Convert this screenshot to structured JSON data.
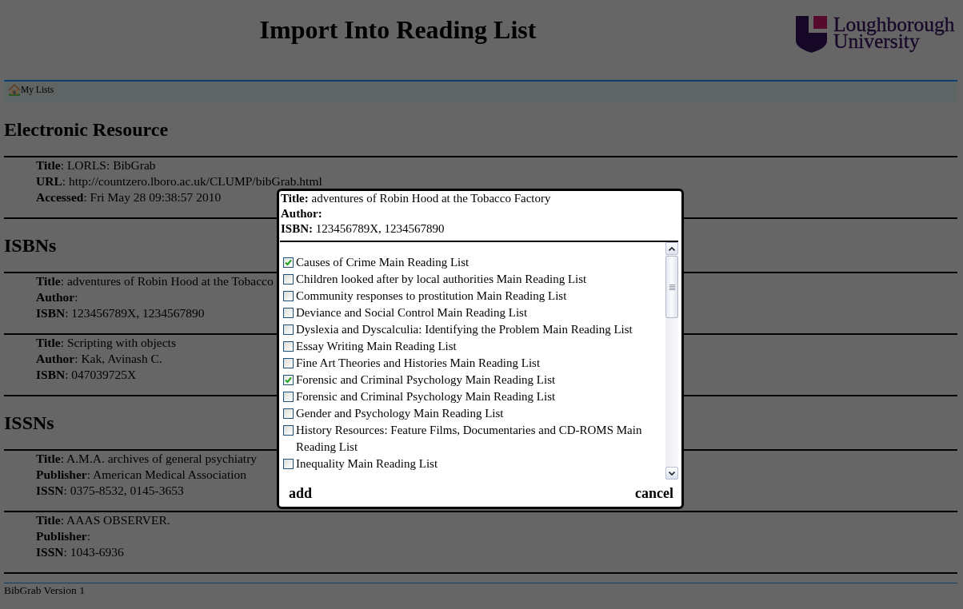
{
  "header": {
    "title": "Import Into Reading List",
    "logo_text": [
      "Loughborough",
      "University"
    ]
  },
  "nav": {
    "link": "My Lists"
  },
  "sections": [
    {
      "heading": "Electronic Resource",
      "records": [
        {
          "fields": [
            "**Title**: LORLS: BibGrab",
            "**URL**: http://countzero.lboro.ac.uk/CLUMP/bibGrab.html",
            "**Accessed**: Fri May 28 09:38:57 2010"
          ]
        }
      ]
    },
    {
      "heading": "ISBNs",
      "records": [
        {
          "fields": [
            "**Title**: adventures of Robin Hood at the Tobacco",
            "**Author**:",
            "**ISBN**: 123456789X, 1234567890"
          ]
        },
        {
          "fields": [
            "**Title**: Scripting with objects",
            "**Author**: Kak, Avinash C.",
            "**ISBN**: 047039725X"
          ]
        }
      ]
    },
    {
      "heading": "ISSNs",
      "records": [
        {
          "fields": [
            "**Title**: A.M.A. archives of general psychiatry",
            "**Publisher**: American Medical Association",
            "**ISSN**: 0375-8532, 0145-3653"
          ]
        },
        {
          "fields": [
            "**Title**: AAAS OBSERVER.",
            "**Publisher**:",
            "**ISSN**: 1043-6936"
          ]
        }
      ]
    }
  ],
  "footer": {
    "version": "BibGrab Version 1"
  },
  "dialog": {
    "fields": [
      {
        "label": "Title:",
        "value": "adventures of Robin Hood at the Tobacco Factory"
      },
      {
        "label": "Author:"
      },
      {
        "label": "ISBN:",
        "value": "123456789X, 1234567890"
      }
    ],
    "lists": [
      {
        "label": "Causes of Crime Main Reading List",
        "checked": true
      },
      {
        "label": "Children looked after by local authorities Main Reading List",
        "checked": false
      },
      {
        "label": "Community responses to prostitution Main Reading List",
        "checked": false
      },
      {
        "label": "Deviance and Social Control Main Reading List",
        "checked": false
      },
      {
        "label": "Dyslexia and Dyscalculia: Identifying the Problem Main Reading List",
        "checked": false
      },
      {
        "label": "Essay Writing Main Reading List",
        "checked": false
      },
      {
        "label": "Fine Art Theories and Histories Main Reading List",
        "checked": false
      },
      {
        "label": "Forensic and Criminal Psychology Main Reading List",
        "checked": true
      },
      {
        "label": "Forensic and Criminal Psychology Main Reading List",
        "checked": false
      },
      {
        "label": "Gender and Psychology Main Reading List",
        "checked": false
      },
      {
        "label": "History Resources: Feature Films, Documentaries and CD-ROMS Main Reading List",
        "checked": false
      },
      {
        "label": "Inequality Main Reading List",
        "checked": false
      }
    ],
    "buttons": {
      "add": "add",
      "cancel": "cancel"
    }
  }
}
